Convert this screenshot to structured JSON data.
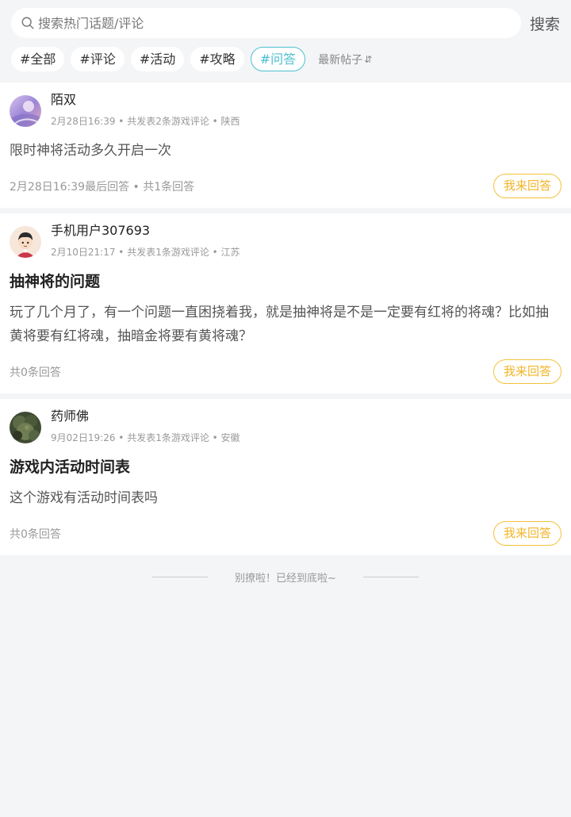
{
  "search": {
    "placeholder": "搜索热门话题/评论",
    "button": "搜索"
  },
  "tags": [
    {
      "label": "#全部"
    },
    {
      "label": "#评论"
    },
    {
      "label": "#活动"
    },
    {
      "label": "#攻略"
    },
    {
      "label": "#问答"
    }
  ],
  "sort": {
    "label": "最新帖子",
    "arrow": "⇵"
  },
  "posts": [
    {
      "username": "陌双",
      "meta": "2月28日16:39 • 共发表2条游戏评论 • 陕西",
      "title": "",
      "body": "限时神将活动多久开启一次",
      "footer": "2月28日16:39最后回答 • 共1条回答",
      "answer_label": "我来回答"
    },
    {
      "username": "手机用户307693",
      "meta": "2月10日21:17 • 共发表1条游戏评论 • 江苏",
      "title": "抽神将的问题",
      "body": "玩了几个月了，有一个问题一直困挠着我，就是抽神将是不是一定要有红将的将魂？比如抽黄将要有红将魂，抽暗金将要有黄将魂？",
      "footer": "共0条回答",
      "answer_label": "我来回答"
    },
    {
      "username": "药师佛",
      "meta": "9月02日19:26 • 共发表1条游戏评论 • 安徽",
      "title": "游戏内活动时间表",
      "body": "这个游戏有活动时间表吗",
      "footer": "共0条回答",
      "answer_label": "我来回答"
    }
  ],
  "end_text": "别撩啦！已经到底啦~",
  "colors": {
    "accent": "#4cbfcf",
    "answer": "#f2b52a",
    "background": "#f4f5f7"
  }
}
